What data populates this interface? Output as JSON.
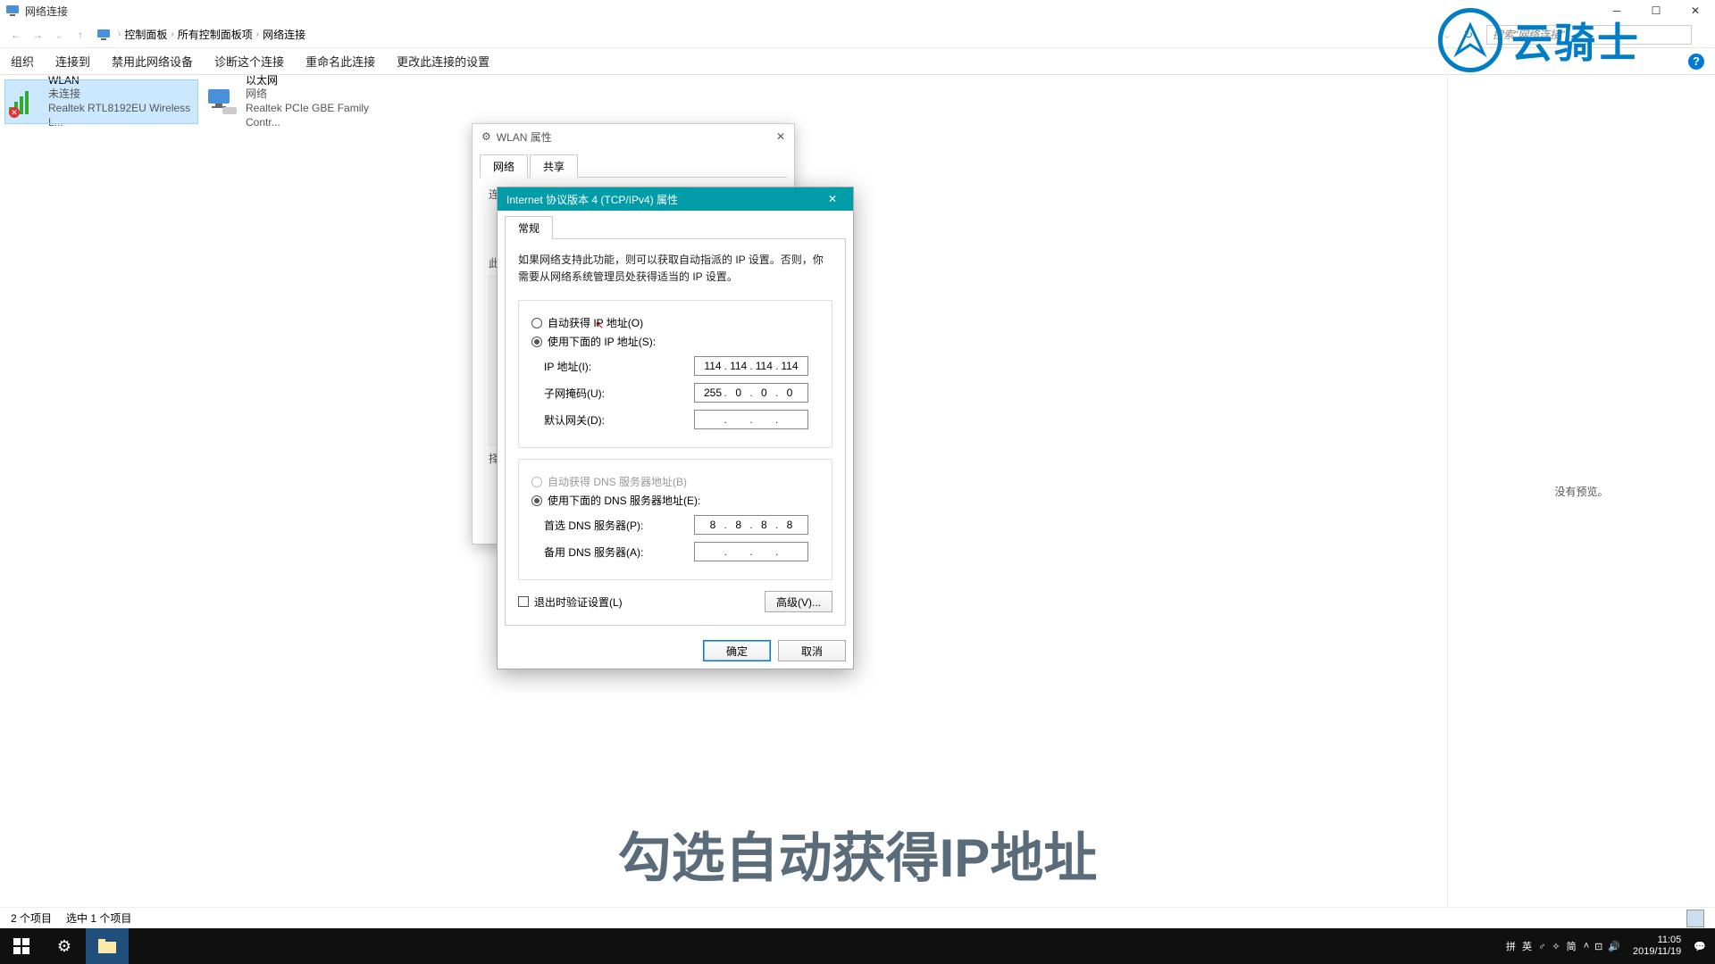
{
  "window_title": "网络连接",
  "breadcrumb": [
    "控制面板",
    "所有控制面板项",
    "网络连接"
  ],
  "search_placeholder": "搜索\"网络连接\"",
  "toolbar": {
    "organize": "组织",
    "connect": "连接到",
    "disable": "禁用此网络设备",
    "diagnose": "诊断这个连接",
    "rename": "重命名此连接",
    "change": "更改此连接的设置"
  },
  "adapters": [
    {
      "name": "WLAN",
      "status": "未连接",
      "device": "Realtek RTL8192EU Wireless L..."
    },
    {
      "name": "以太网",
      "status": "网络",
      "device": "Realtek PCIe GBE Family Contr..."
    }
  ],
  "preview_text": "没有预览。",
  "statusbar": {
    "items": "2 个项目",
    "selected": "选中 1 个项目"
  },
  "wlan_dialog": {
    "title": "WLAN 属性",
    "tabs": {
      "network": "网络",
      "share": "共享"
    },
    "connect_label": "连",
    "body_line1": "此",
    "body_line2": "择"
  },
  "ipv4": {
    "title": "Internet 协议版本 4 (TCP/IPv4) 属性",
    "tab_general": "常规",
    "desc": "如果网络支持此功能，则可以获取自动指派的 IP 设置。否则，你需要从网络系统管理员处获得适当的 IP 设置。",
    "radio_auto_ip": "自动获得 IP 地址(O)",
    "radio_manual_ip": "使用下面的 IP 地址(S):",
    "lbl_ip": "IP 地址(I):",
    "lbl_mask": "子网掩码(U):",
    "lbl_gateway": "默认网关(D):",
    "ip": [
      "114",
      "114",
      "114",
      "114"
    ],
    "mask": [
      "255",
      "0",
      "0",
      "0"
    ],
    "gateway": [
      "",
      "",
      "",
      ""
    ],
    "radio_auto_dns": "自动获得 DNS 服务器地址(B)",
    "radio_manual_dns": "使用下面的 DNS 服务器地址(E):",
    "lbl_dns1": "首选 DNS 服务器(P):",
    "lbl_dns2": "备用 DNS 服务器(A):",
    "dns1": [
      "8",
      "8",
      "8",
      "8"
    ],
    "dns2": [
      "",
      "",
      "",
      ""
    ],
    "chk_validate": "退出时验证设置(L)",
    "btn_advanced": "高级(V)...",
    "btn_ok": "确定",
    "btn_cancel": "取消"
  },
  "logo_text": "云骑士",
  "caption": "勾选自动获得IP地址",
  "taskbar": {
    "ime": "拼 英 ♂ ✧ 简",
    "time": "11:05",
    "date": "2019/11/19"
  }
}
